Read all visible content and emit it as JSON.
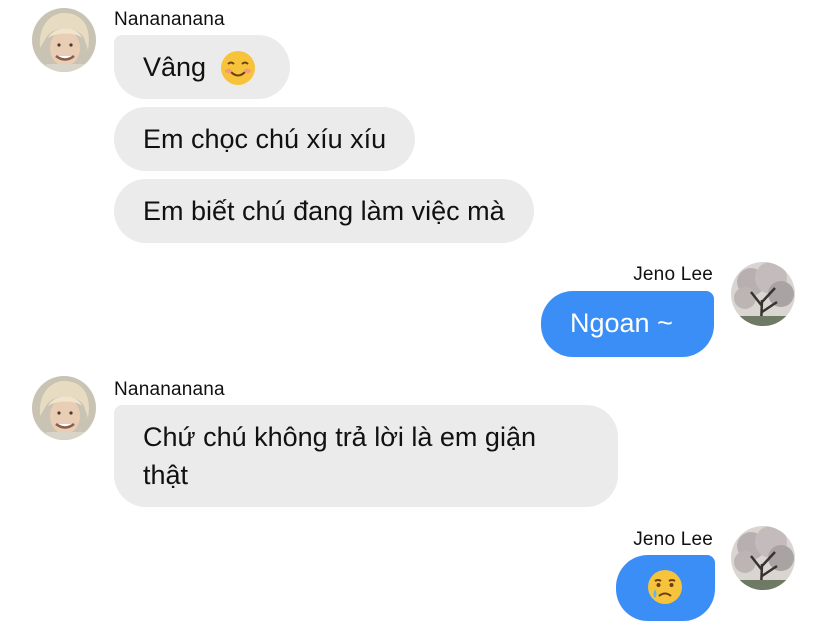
{
  "conversation": {
    "participants": {
      "them": {
        "name": "Nanananana",
        "avatar_icon": "blonde-person-avatar-icon"
      },
      "me": {
        "name": "Jeno Lee",
        "avatar_icon": "cherry-blossom-tree-avatar-icon"
      }
    },
    "groups": [
      {
        "sender_name": "Nanananana",
        "messages": [
          {
            "text": "Vâng",
            "emoji": "smiling-face-icon"
          },
          {
            "text": "Em chọc chú xíu xíu"
          },
          {
            "text": "Em biết chú đang làm việc mà"
          }
        ]
      },
      {
        "sender_name": "Jeno Lee",
        "messages": [
          {
            "text": "Ngoan ~"
          }
        ]
      },
      {
        "sender_name": "Nanananana",
        "messages": [
          {
            "text_line1": "Chứ chú không trả lời là em giận",
            "text_line2": "thật"
          }
        ]
      },
      {
        "sender_name": "Jeno Lee",
        "messages": [
          {
            "emoji": "crying-face-icon"
          }
        ]
      }
    ],
    "colors": {
      "incoming_bubble": "#ebebeb",
      "outgoing_bubble": "#3a8ef6",
      "outgoing_text": "#ffffff",
      "incoming_text": "#111111"
    }
  }
}
